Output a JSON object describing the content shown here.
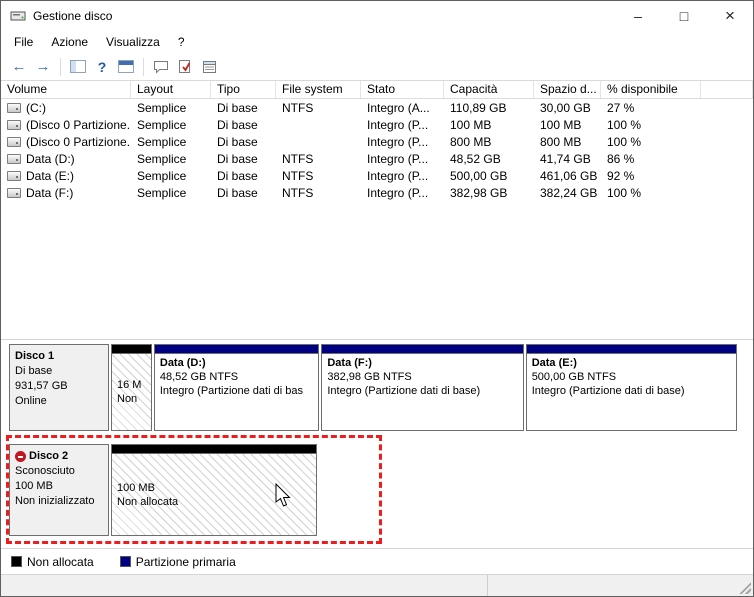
{
  "window": {
    "title": "Gestione disco",
    "minimize": "–",
    "maximize": "□",
    "close": "×"
  },
  "menu": {
    "items": [
      "File",
      "Azione",
      "Visualizza",
      "?"
    ]
  },
  "toolbar": {
    "icons": [
      {
        "name": "back-icon",
        "glyph": "←"
      },
      {
        "name": "forward-icon",
        "glyph": "→"
      },
      {
        "name": "console-tree-icon",
        "glyph": ""
      },
      {
        "name": "help-icon",
        "glyph": "?"
      },
      {
        "name": "details-pane-icon",
        "glyph": ""
      },
      {
        "name": "speech-bubble-icon",
        "glyph": ""
      },
      {
        "name": "check-report-icon",
        "glyph": ""
      },
      {
        "name": "properties-pane-icon",
        "glyph": ""
      }
    ]
  },
  "table": {
    "columns": {
      "volume": "Volume",
      "layout": "Layout",
      "tipo": "Tipo",
      "fs": "File system",
      "stato": "Stato",
      "capacita": "Capacità",
      "spazio": "Spazio d...",
      "pct": "% disponibile"
    },
    "rows": [
      {
        "volume": "(C:)",
        "layout": "Semplice",
        "tipo": "Di base",
        "fs": "NTFS",
        "stato": "Integro (A...",
        "capacita": "110,89 GB",
        "spazio": "30,00 GB",
        "pct": "27 %"
      },
      {
        "volume": "(Disco 0 Partizione...",
        "layout": "Semplice",
        "tipo": "Di base",
        "fs": "",
        "stato": "Integro (P...",
        "capacita": "100 MB",
        "spazio": "100 MB",
        "pct": "100 %"
      },
      {
        "volume": "(Disco 0 Partizione...",
        "layout": "Semplice",
        "tipo": "Di base",
        "fs": "",
        "stato": "Integro (P...",
        "capacita": "800 MB",
        "spazio": "800 MB",
        "pct": "100 %"
      },
      {
        "volume": "Data (D:)",
        "layout": "Semplice",
        "tipo": "Di base",
        "fs": "NTFS",
        "stato": "Integro (P...",
        "capacita": "48,52 GB",
        "spazio": "41,74 GB",
        "pct": "86 %"
      },
      {
        "volume": "Data (E:)",
        "layout": "Semplice",
        "tipo": "Di base",
        "fs": "NTFS",
        "stato": "Integro (P...",
        "capacita": "500,00 GB",
        "spazio": "461,06 GB",
        "pct": "92 %"
      },
      {
        "volume": "Data (F:)",
        "layout": "Semplice",
        "tipo": "Di base",
        "fs": "NTFS",
        "stato": "Integro (P...",
        "capacita": "382,98 GB",
        "spazio": "382,24 GB",
        "pct": "100 %"
      }
    ]
  },
  "disks": [
    {
      "name": "Disco 1",
      "type": "Di base",
      "size": "931,57 GB",
      "status": "Online",
      "partitions": [
        {
          "kind": "unallocated",
          "line1": "16 M",
          "line2": "Non"
        },
        {
          "kind": "primary",
          "title": "Data (D:)",
          "size": "48,52 GB NTFS",
          "status": "Integro (Partizione dati di bas"
        },
        {
          "kind": "primary",
          "title": "Data (F:)",
          "size": "382,98 GB NTFS",
          "status": "Integro (Partizione dati di base)"
        },
        {
          "kind": "primary",
          "title": "Data (E:)",
          "size": "500,00 GB NTFS",
          "status": "Integro (Partizione dati di base)"
        }
      ]
    },
    {
      "name": "Disco 2",
      "type": "Sconosciuto",
      "size": "100 MB",
      "status": "Non inizializzato",
      "partitions": [
        {
          "kind": "unallocated",
          "line1": "100 MB",
          "line2": "Non allocata"
        }
      ]
    }
  ],
  "legend": {
    "items": [
      {
        "label": "Non allocata",
        "color": "#000000"
      },
      {
        "label": "Partizione primaria",
        "color": "#000082"
      }
    ]
  },
  "colors": {
    "primary_partition": "#000082",
    "unallocated": "#000000",
    "highlight_border": "#ee1c1c"
  }
}
